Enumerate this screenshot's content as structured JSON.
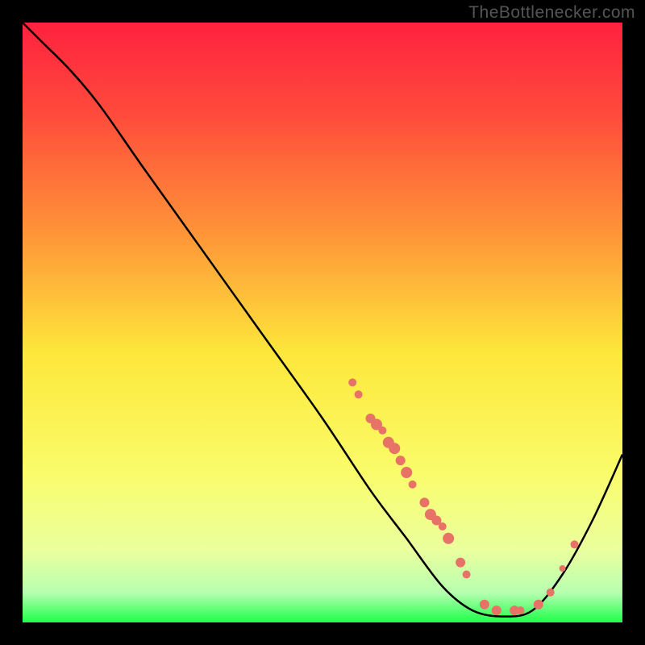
{
  "watermark": "TheBottlenecker.com",
  "chart_data": {
    "type": "line",
    "title": "",
    "xlabel": "",
    "ylabel": "",
    "xlim": [
      0,
      100
    ],
    "ylim": [
      0,
      100
    ],
    "gradient_stops": [
      {
        "offset": 0,
        "color": "#ff213f"
      },
      {
        "offset": 0.15,
        "color": "#ff4a3c"
      },
      {
        "offset": 0.35,
        "color": "#ff9438"
      },
      {
        "offset": 0.55,
        "color": "#fde73a"
      },
      {
        "offset": 0.75,
        "color": "#fafc6a"
      },
      {
        "offset": 0.88,
        "color": "#eaff9e"
      },
      {
        "offset": 0.95,
        "color": "#b8ffb0"
      },
      {
        "offset": 1.0,
        "color": "#1dff4a"
      }
    ],
    "curve": [
      {
        "x": 0,
        "y": 100
      },
      {
        "x": 3,
        "y": 97
      },
      {
        "x": 8,
        "y": 92
      },
      {
        "x": 13,
        "y": 86
      },
      {
        "x": 20,
        "y": 76
      },
      {
        "x": 30,
        "y": 62
      },
      {
        "x": 40,
        "y": 48
      },
      {
        "x": 50,
        "y": 34
      },
      {
        "x": 58,
        "y": 22
      },
      {
        "x": 64,
        "y": 14
      },
      {
        "x": 70,
        "y": 6
      },
      {
        "x": 75,
        "y": 2
      },
      {
        "x": 80,
        "y": 1
      },
      {
        "x": 85,
        "y": 2
      },
      {
        "x": 90,
        "y": 8
      },
      {
        "x": 95,
        "y": 17
      },
      {
        "x": 100,
        "y": 28
      }
    ],
    "dot_clusters": [
      {
        "x": 55,
        "y": 40,
        "r": 5
      },
      {
        "x": 56,
        "y": 38,
        "r": 5
      },
      {
        "x": 58,
        "y": 34,
        "r": 6
      },
      {
        "x": 59,
        "y": 33,
        "r": 7
      },
      {
        "x": 60,
        "y": 32,
        "r": 5
      },
      {
        "x": 61,
        "y": 30,
        "r": 7
      },
      {
        "x": 62,
        "y": 29,
        "r": 7
      },
      {
        "x": 63,
        "y": 27,
        "r": 6
      },
      {
        "x": 64,
        "y": 25,
        "r": 7
      },
      {
        "x": 65,
        "y": 23,
        "r": 5
      },
      {
        "x": 67,
        "y": 20,
        "r": 6
      },
      {
        "x": 68,
        "y": 18,
        "r": 7
      },
      {
        "x": 69,
        "y": 17,
        "r": 6
      },
      {
        "x": 70,
        "y": 16,
        "r": 5
      },
      {
        "x": 71,
        "y": 14,
        "r": 7
      },
      {
        "x": 73,
        "y": 10,
        "r": 6
      },
      {
        "x": 74,
        "y": 8,
        "r": 5
      },
      {
        "x": 77,
        "y": 3,
        "r": 6
      },
      {
        "x": 79,
        "y": 2,
        "r": 6
      },
      {
        "x": 82,
        "y": 2,
        "r": 6
      },
      {
        "x": 83,
        "y": 2,
        "r": 5
      },
      {
        "x": 86,
        "y": 3,
        "r": 6
      },
      {
        "x": 88,
        "y": 5,
        "r": 5
      },
      {
        "x": 90,
        "y": 9,
        "r": 4
      },
      {
        "x": 92,
        "y": 13,
        "r": 5
      }
    ],
    "curve_color": "#000000",
    "dot_color": "#e77367"
  }
}
